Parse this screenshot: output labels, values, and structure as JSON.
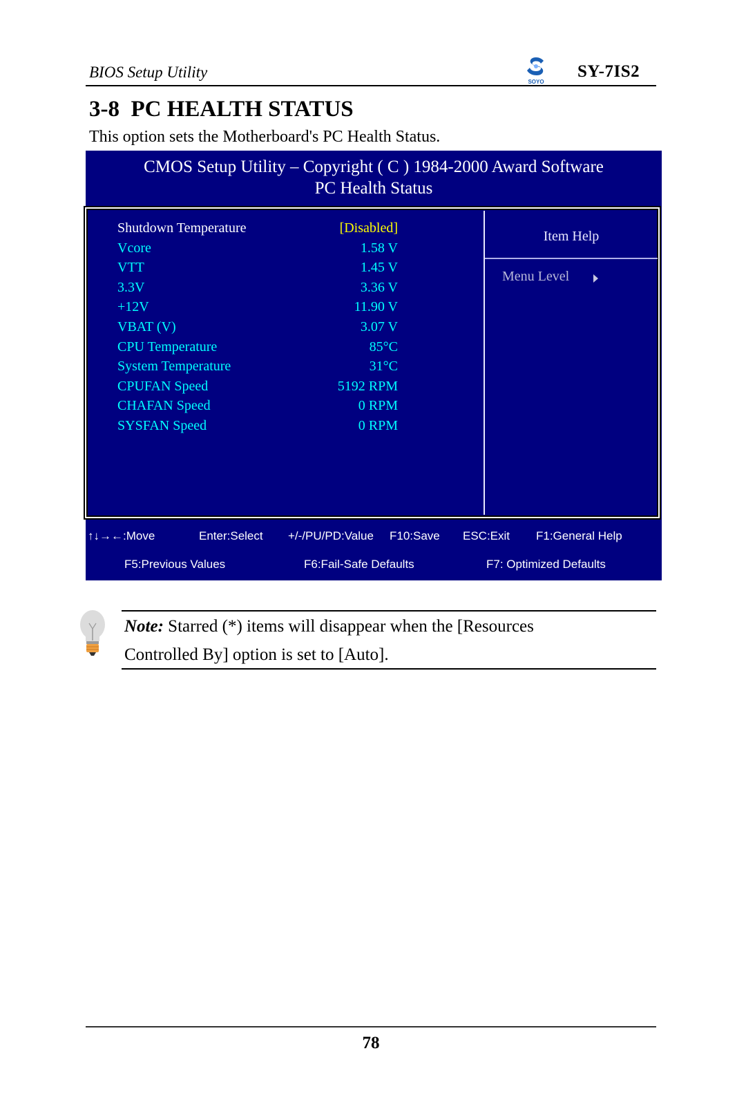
{
  "header": {
    "running_title": "BIOS Setup Utility",
    "model": "SY-7IS2",
    "logo_text": "SOYO"
  },
  "section": {
    "title": "3-8  PC HEALTH STATUS",
    "description": "This option sets the Motherboard's PC Health Status."
  },
  "bios": {
    "title_line1": "CMOS Setup Utility – Copyright ( C ) 1984-2000 Award Software",
    "title_line2": "PC Health Status",
    "items": [
      {
        "label": "Shutdown Temperature",
        "value": "[Disabled]",
        "selected": true
      },
      {
        "label": "Vcore",
        "value": "1.58 V"
      },
      {
        "label": "VTT",
        "value": "1.45 V"
      },
      {
        "label": "3.3V",
        "value": "3.36 V"
      },
      {
        "label": "+12V",
        "value": "11.90 V"
      },
      {
        "label": "VBAT (V)",
        "value": "3.07 V"
      },
      {
        "label": "CPU Temperature",
        "value": "85°C"
      },
      {
        "label": "System Temperature",
        "value": "31°C"
      },
      {
        "label": "CPUFAN Speed",
        "value": "5192 RPM"
      },
      {
        "label": "CHAFAN Speed",
        "value": "0 RPM"
      },
      {
        "label": "SYSFAN Speed",
        "value": "0 RPM"
      }
    ],
    "help": {
      "title": "Item Help",
      "menu_level": "Menu Level"
    },
    "keys_row1": [
      {
        "label": "↑↓→←:Move"
      },
      {
        "label": "Enter:Select"
      },
      {
        "label": "+/-/PU/PD:Value"
      },
      {
        "label": "F10:Save"
      },
      {
        "label": "ESC:Exit"
      },
      {
        "label": "F1:General Help"
      }
    ],
    "keys_row2": [
      {
        "label": "F5:Previous Values"
      },
      {
        "label": "F6:Fail-Safe Defaults"
      },
      {
        "label": "F7: Optimized Defaults"
      }
    ],
    "colors": {
      "background": "#000080",
      "item_text": "#00ffff",
      "selected_value": "#ffff00",
      "selected_label": "#ffffff"
    }
  },
  "note": {
    "prefix": "Note:",
    "line1": " Starred (*) items will disappear when the [Resources",
    "line2": "Controlled By] option is set to [Auto]."
  },
  "footer": {
    "page_number": "78"
  }
}
